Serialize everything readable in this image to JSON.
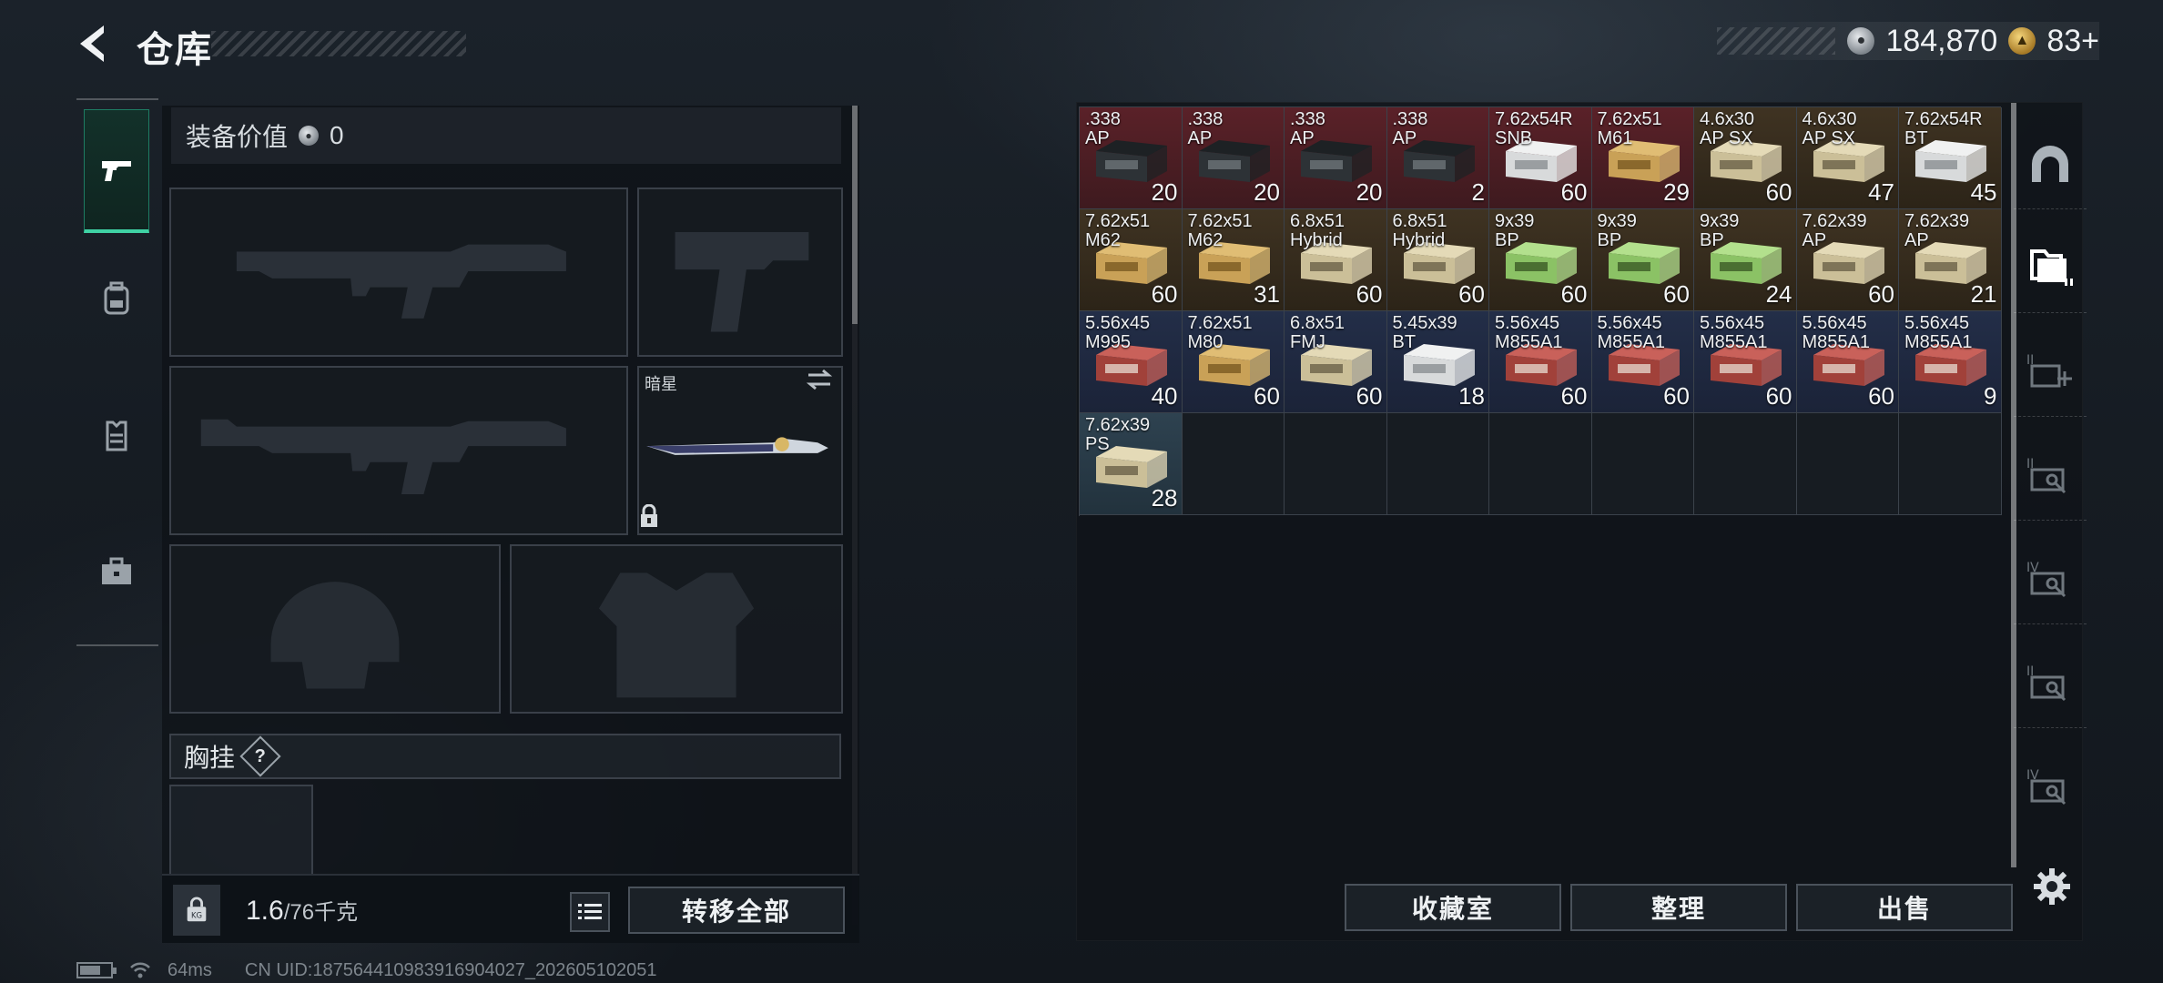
{
  "header": {
    "title": "仓库",
    "currencies": [
      {
        "name": "silver-coin",
        "value": "184,870"
      },
      {
        "name": "gold-coin",
        "value": "83+"
      }
    ]
  },
  "left_tabs": [
    {
      "icon": "pistol-icon",
      "active": true
    },
    {
      "icon": "backpack-icon",
      "active": false
    },
    {
      "icon": "vest-icon",
      "active": false
    },
    {
      "icon": "toolbox-icon",
      "active": false
    }
  ],
  "loadout": {
    "value_label": "装备价值",
    "value": "0",
    "melee_name": "暗星",
    "chest_label": "胸挂",
    "help_mark": "?",
    "weight_current": "1.6",
    "weight_capacity": "/76千克",
    "transfer_all": "转移全部"
  },
  "storage": {
    "items": [
      {
        "name": ".338\nAP",
        "qty": "20",
        "color": "red",
        "box": "dark"
      },
      {
        "name": ".338\nAP",
        "qty": "20",
        "color": "red",
        "box": "dark"
      },
      {
        "name": ".338\nAP",
        "qty": "20",
        "color": "red",
        "box": "dark"
      },
      {
        "name": ".338\nAP",
        "qty": "2",
        "color": "red",
        "box": "dark"
      },
      {
        "name": "7.62x54R\nSNB",
        "qty": "60",
        "color": "red",
        "box": "white"
      },
      {
        "name": "7.62x51\nM61",
        "qty": "29",
        "color": "red",
        "box": "tan"
      },
      {
        "name": "4.6x30\nAP SX",
        "qty": "60",
        "color": "brown",
        "box": "cream"
      },
      {
        "name": "4.6x30\nAP SX",
        "qty": "47",
        "color": "brown",
        "box": "cream"
      },
      {
        "name": "7.62x54R\nBT",
        "qty": "45",
        "color": "brown",
        "box": "white"
      },
      {
        "name": "7.62x51\nM62",
        "qty": "60",
        "color": "brown",
        "box": "tan"
      },
      {
        "name": "7.62x51\nM62",
        "qty": "31",
        "color": "brown",
        "box": "tan"
      },
      {
        "name": "6.8x51\nHybrid",
        "qty": "60",
        "color": "brown",
        "box": "cream"
      },
      {
        "name": "6.8x51\nHybrid",
        "qty": "60",
        "color": "brown",
        "box": "cream"
      },
      {
        "name": "9x39\nBP",
        "qty": "60",
        "color": "brown",
        "box": "green"
      },
      {
        "name": "9x39\nBP",
        "qty": "60",
        "color": "brown",
        "box": "green"
      },
      {
        "name": "9x39\nBP",
        "qty": "24",
        "color": "brown",
        "box": "green"
      },
      {
        "name": "7.62x39\nAP",
        "qty": "60",
        "color": "brown",
        "box": "cream"
      },
      {
        "name": "7.62x39\nAP",
        "qty": "21",
        "color": "brown",
        "box": "cream"
      },
      {
        "name": "5.56x45\nM995",
        "qty": "40",
        "color": "navy",
        "box": "red"
      },
      {
        "name": "7.62x51\nM80",
        "qty": "60",
        "color": "navy",
        "box": "tan"
      },
      {
        "name": "6.8x51\nFMJ",
        "qty": "60",
        "color": "navy",
        "box": "cream"
      },
      {
        "name": "5.45x39\nBT",
        "qty": "18",
        "color": "navy",
        "box": "white"
      },
      {
        "name": "5.56x45\nM855A1",
        "qty": "60",
        "color": "navy",
        "box": "red"
      },
      {
        "name": "5.56x45\nM855A1",
        "qty": "60",
        "color": "navy",
        "box": "red"
      },
      {
        "name": "5.56x45\nM855A1",
        "qty": "60",
        "color": "navy",
        "box": "red"
      },
      {
        "name": "5.56x45\nM855A1",
        "qty": "60",
        "color": "navy",
        "box": "red"
      },
      {
        "name": "5.56x45\nM855A1",
        "qty": "9",
        "color": "navy",
        "box": "red"
      },
      {
        "name": "7.62x39\nPS",
        "qty": "28",
        "color": "teal",
        "box": "cream"
      }
    ],
    "total_cells": 36
  },
  "actions": {
    "collection": "收藏室",
    "sort": "整理",
    "sell": "出售"
  },
  "status": {
    "ping": "64ms",
    "uid": "CN UID:187564410983916904027_202605102051"
  },
  "colors": {
    "accent": "#3fd2a4",
    "rarity_red": "#5a2128",
    "rarity_gold": "#3f3322",
    "rarity_blue": "#232e48",
    "rarity_teal": "#2e4250"
  }
}
